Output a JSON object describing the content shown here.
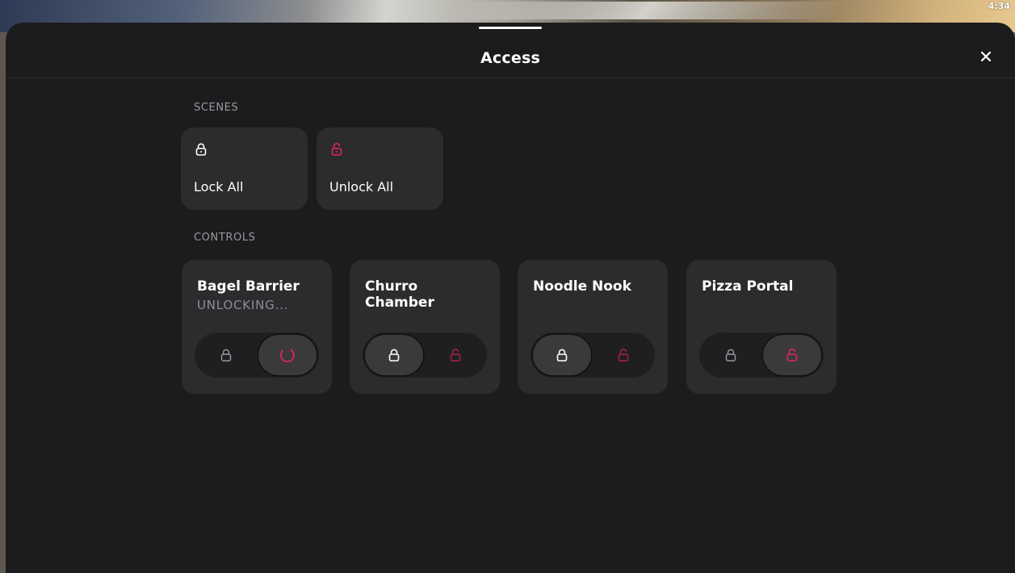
{
  "status_bar": {
    "time": "4:34"
  },
  "sheet": {
    "title": "Access"
  },
  "colors": {
    "accent": "#e0245e",
    "icon_light": "#ffffff",
    "icon_dim": "#9a9a9e"
  },
  "scenes": {
    "header": "SCENES",
    "items": [
      {
        "label": "Lock All",
        "icon": "lock-icon"
      },
      {
        "label": "Unlock All",
        "icon": "unlock-icon"
      }
    ]
  },
  "controls": {
    "header": "CONTROLS",
    "items": [
      {
        "name": "Bagel Barrier",
        "status": "UNLOCKING...",
        "selected": "unlock-pending"
      },
      {
        "name": "Churro Chamber",
        "status": "",
        "selected": "lock"
      },
      {
        "name": "Noodle Nook",
        "status": "",
        "selected": "lock"
      },
      {
        "name": "Pizza Portal",
        "status": "",
        "selected": "unlock"
      }
    ]
  }
}
